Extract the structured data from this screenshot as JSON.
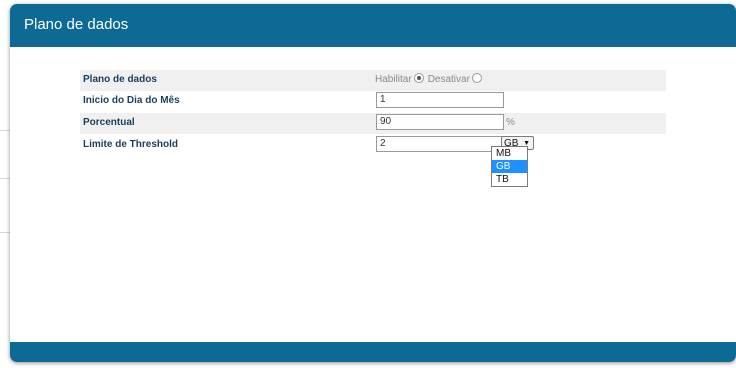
{
  "panel": {
    "title": "Plano de dados"
  },
  "rows": {
    "plan": {
      "label": "Plano de dados",
      "enable_label": "Habilitar",
      "disable_label": "Desativar",
      "selected": "Habilitar"
    },
    "start_day": {
      "label": "Inicio do Dia do Mês",
      "value": "1"
    },
    "percent": {
      "label": "Porcentual",
      "value": "90",
      "suffix": "%"
    },
    "threshold": {
      "label": "Limite de Threshold",
      "value": "2",
      "unit": "GB"
    }
  },
  "unit_options": [
    "MB",
    "GB",
    "TB"
  ],
  "colors": {
    "header": "#0d6a94",
    "label": "#1b3d5c",
    "selected_option": "#1e90ff"
  }
}
